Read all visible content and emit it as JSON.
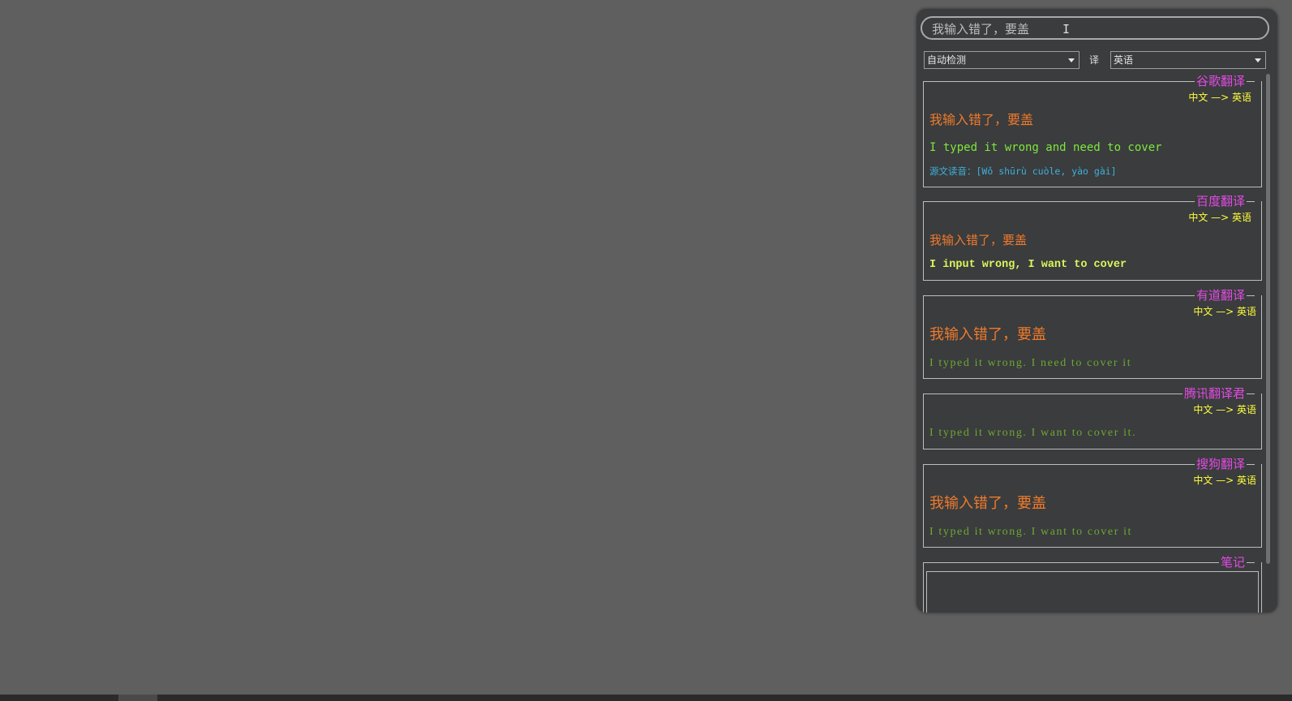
{
  "search": {
    "value": "我输入错了，要盖"
  },
  "language_bar": {
    "source": "自动检测",
    "separator": "译",
    "target": "英语"
  },
  "cards": {
    "google": {
      "title": "谷歌翻译",
      "direction": "中文 —> 英语",
      "source_text": "我输入错了，要盖",
      "translation": "I typed it wrong and need to cover",
      "phonetic": "源文读音：[Wǒ shūrù cuòle, yào gài]"
    },
    "baidu": {
      "title": "百度翻译",
      "direction": "中文 —> 英语",
      "source_text": "我输入错了，要盖",
      "translation": "I input wrong, I want to cover"
    },
    "youdao": {
      "title": "有道翻译",
      "direction": "中文 —> 英语",
      "source_text": "我输入错了，要盖",
      "translation": "I typed it wrong. I need to cover it"
    },
    "tencent": {
      "title": "腾讯翻译君",
      "direction": "中文 —> 英语",
      "translation": "I typed it wrong. I want to cover it."
    },
    "sogou": {
      "title": "搜狗翻译",
      "direction": "中文 —> 英语",
      "source_text": "我输入错了，要盖",
      "translation": "I typed it wrong. I want to cover it"
    },
    "notes": {
      "title": "笔记"
    }
  },
  "colors": {
    "panel_bg": "#3a3c3e",
    "desktop_bg": "#5f5f5f",
    "title": "#e34ae3",
    "direction": "#ffff3a",
    "source": "#f07a2a",
    "phonetic": "#3fb1dc",
    "translation_bright": "#7ee83a",
    "translation_dim": "#6fa830"
  }
}
